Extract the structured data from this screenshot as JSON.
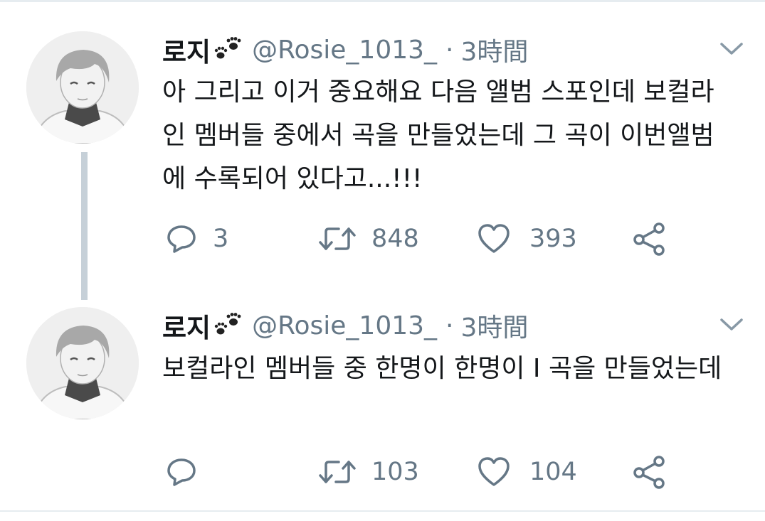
{
  "tweets": [
    {
      "author_name": "로지",
      "author_emoji": "paw-prints-icon",
      "handle": "@Rosie_1013_",
      "separator": "·",
      "time": "3時間",
      "text": "아 그리고 이거 중요해요 다음 앨범 스포인데 보컬라인 멤버들 중에서 곡을 만들었는데 그 곡이 이번앨범에 수록되어 있다고...!!!",
      "replies": "3",
      "retweets": "848",
      "likes": "393"
    },
    {
      "author_name": "로지",
      "author_emoji": "paw-prints-icon",
      "handle": "@Rosie_1013_",
      "separator": "·",
      "time": "3時間",
      "text": "보컬라인 멤버들 중 한명이 한명이 I 곡을 만들었는데",
      "replies": "",
      "retweets": "103",
      "likes": "104"
    }
  ],
  "colors": {
    "text_primary": "#14171a",
    "text_secondary": "#657786",
    "thread_line": "#c6d0d8",
    "divider": "#e6ecf0"
  }
}
